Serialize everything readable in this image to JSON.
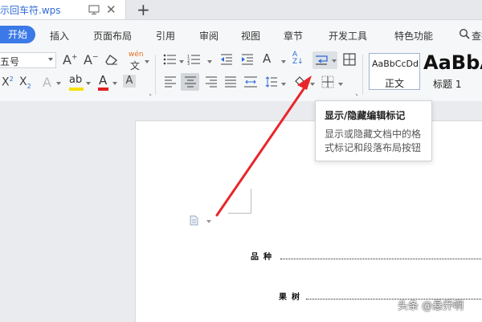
{
  "tabbar": {
    "document_title": "示回车符.wps",
    "new_tab_icon": "plus-icon"
  },
  "menu": {
    "start": "开始",
    "items": [
      "插入",
      "页面布局",
      "引用",
      "审阅",
      "视图",
      "章节",
      "开发工具",
      "特色功能"
    ],
    "search_label": "查找"
  },
  "ribbon": {
    "font_size_value": "五号",
    "phonetic_label": "wén",
    "styles": {
      "normal_sample": "AaBbCcDd",
      "normal_name": "正文",
      "heading_sample": "AaBbA",
      "heading_name": "标题 1"
    }
  },
  "tooltip": {
    "title": "显示/隐藏编辑标记",
    "body": "显示或隐藏文档中的格式标记和段落布局按钮"
  },
  "document": {
    "field1_label": "品种",
    "field2_label": "果树"
  },
  "watermark": "头条 @悬乔啊",
  "colors": {
    "accent": "#3b79e8",
    "highlight_yellow": "#f5e100",
    "font_red": "#e02020",
    "arrow_red": "#e8262a"
  }
}
